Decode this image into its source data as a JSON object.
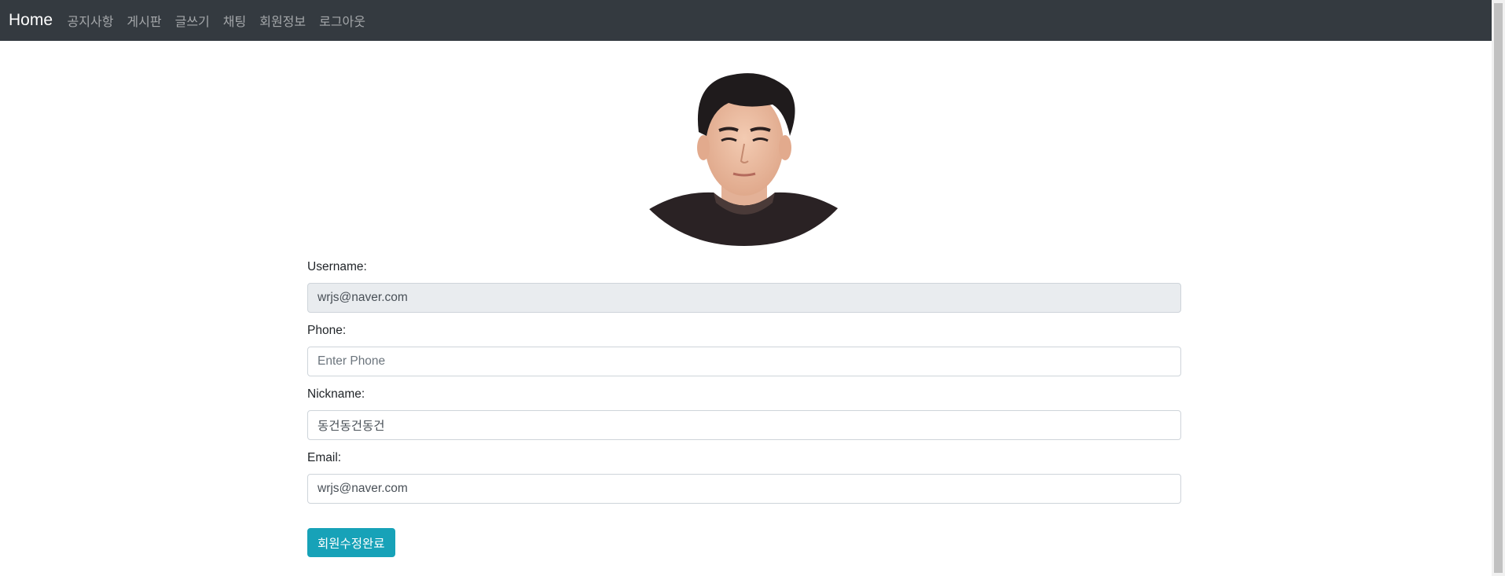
{
  "navbar": {
    "brand": "Home",
    "links": [
      "공지사항",
      "게시판",
      "글쓰기",
      "채팅",
      "회원정보",
      "로그아웃"
    ]
  },
  "profile": {
    "image_description": "profile-photo"
  },
  "form": {
    "username": {
      "label": "Username:",
      "value": "wrjs@naver.com",
      "readonly": true
    },
    "phone": {
      "label": "Phone:",
      "value": "",
      "placeholder": "Enter Phone"
    },
    "nickname": {
      "label": "Nickname:",
      "value": "동건동건동건"
    },
    "email": {
      "label": "Email:",
      "value": "wrjs@naver.com"
    },
    "submit_label": "회원수정완료"
  },
  "colors": {
    "navbar_bg": "#343a40",
    "button_bg": "#17a2b8",
    "readonly_bg": "#e9ecef"
  }
}
